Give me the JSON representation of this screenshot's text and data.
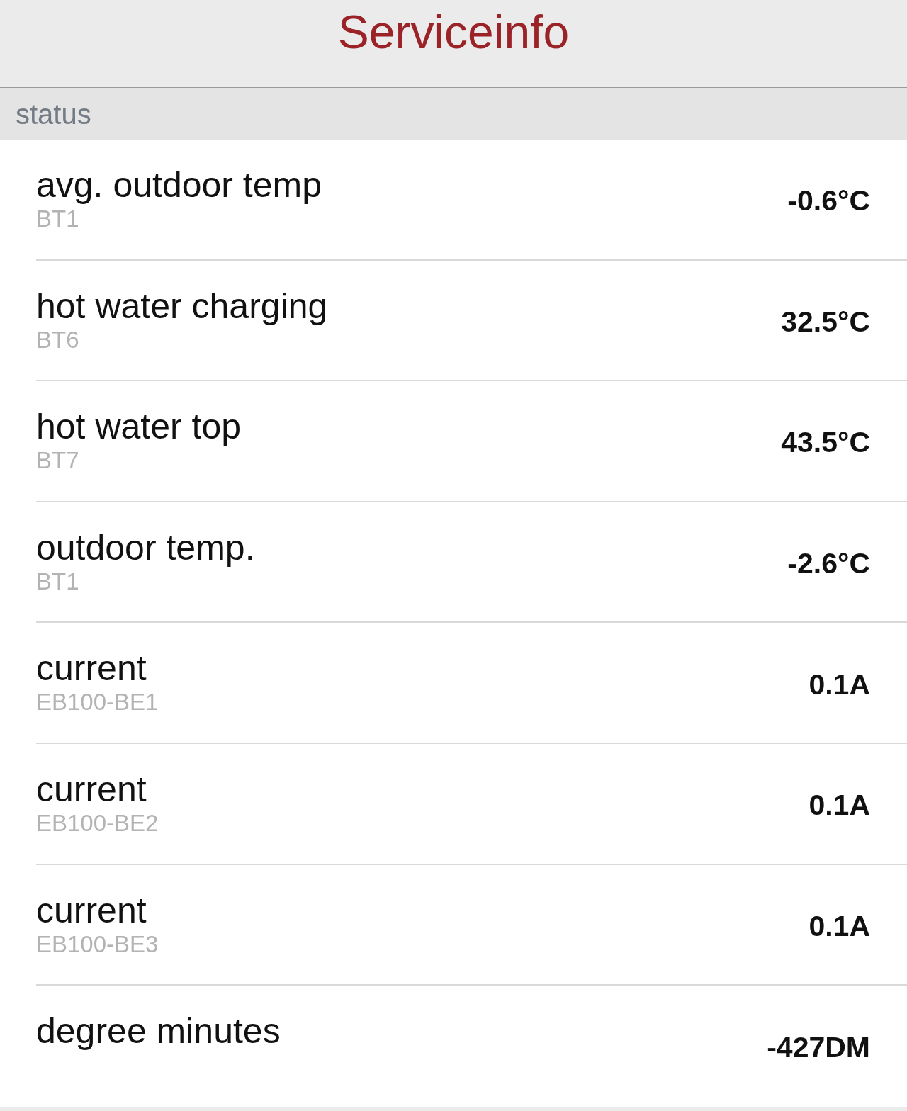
{
  "header": {
    "title": "Serviceinfo"
  },
  "section": {
    "title": "status",
    "rows": [
      {
        "label": "avg. outdoor temp",
        "sensor": "BT1",
        "value": "-0.6°C"
      },
      {
        "label": "hot water charging",
        "sensor": "BT6",
        "value": "32.5°C"
      },
      {
        "label": "hot water top",
        "sensor": "BT7",
        "value": "43.5°C"
      },
      {
        "label": "outdoor temp.",
        "sensor": "BT1",
        "value": "-2.6°C"
      },
      {
        "label": "current",
        "sensor": "EB100-BE1",
        "value": "0.1A"
      },
      {
        "label": "current",
        "sensor": "EB100-BE2",
        "value": "0.1A"
      },
      {
        "label": "current",
        "sensor": "EB100-BE3",
        "value": "0.1A"
      },
      {
        "label": "degree minutes",
        "value": "-427DM"
      }
    ]
  }
}
